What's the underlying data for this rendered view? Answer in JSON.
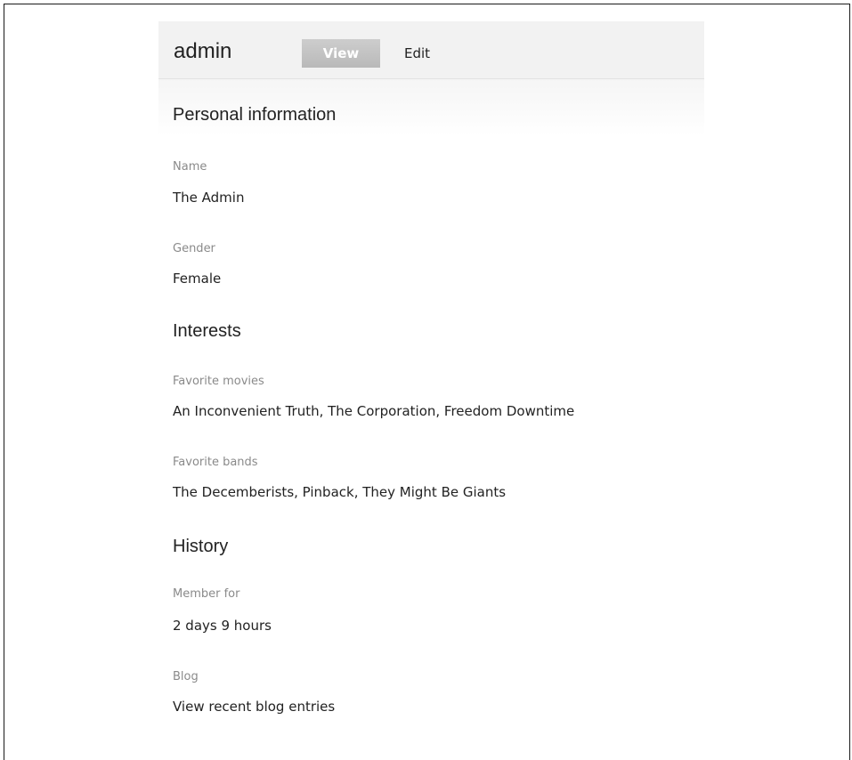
{
  "user": {
    "name": "admin"
  },
  "tabs": {
    "view": "View",
    "edit": "Edit"
  },
  "sections": {
    "personal": {
      "heading": "Personal information",
      "fields": [
        {
          "label": "Name",
          "value": "The Admin"
        },
        {
          "label": "Gender",
          "value": "Female"
        }
      ]
    },
    "interests": {
      "heading": "Interests",
      "fields": [
        {
          "label": "Favorite movies",
          "value": "An Inconvenient Truth, The Corporation, Freedom Downtime"
        },
        {
          "label": "Favorite bands",
          "value": "The Decemberists, Pinback, They Might Be Giants"
        }
      ]
    },
    "history": {
      "heading": "History",
      "fields": [
        {
          "label": "Member for",
          "value": "2 days 9 hours"
        },
        {
          "label": "Blog",
          "value": "View recent blog entries"
        }
      ]
    }
  }
}
